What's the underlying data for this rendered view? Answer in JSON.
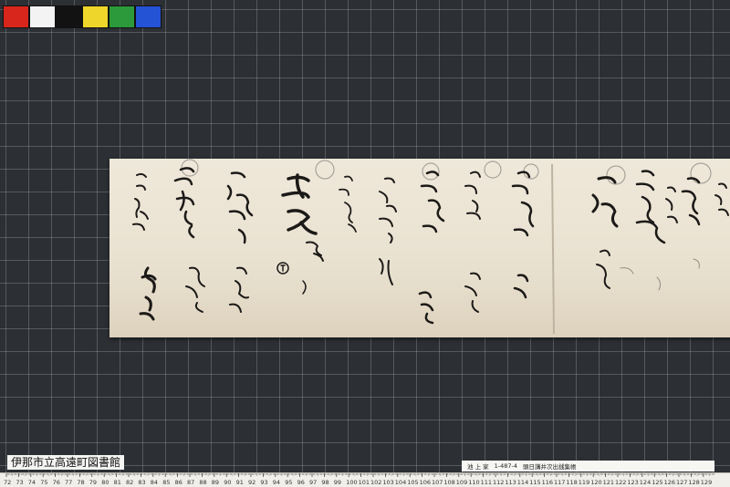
{
  "color_chart": {
    "swatches": [
      "#d9261c",
      "#f3f3f3",
      "#121212",
      "#efd62a",
      "#2c9a3a",
      "#2453d6"
    ]
  },
  "library_label": "伊那市立高遠町図書館",
  "catalog": {
    "location": "池 上 家",
    "number": "1-487-4",
    "title": "頭日講井次出銭集帳"
  },
  "ruler": {
    "ticks": [
      "72",
      "73",
      "74",
      "75",
      "76",
      "77",
      "78",
      "79",
      "80",
      "81",
      "82",
      "83",
      "84",
      "85",
      "86",
      "87",
      "88",
      "89",
      "90",
      "91",
      "92",
      "93",
      "94",
      "95",
      "96",
      "97",
      "98",
      "99",
      "100",
      "101",
      "102",
      "103",
      "104",
      "105",
      "106",
      "107",
      "108",
      "109",
      "110",
      "111",
      "112",
      "113",
      "114",
      "115",
      "116",
      "117",
      "118",
      "119",
      "120",
      "121",
      "122",
      "123",
      "124",
      "125",
      "126",
      "127",
      "128",
      "129"
    ]
  }
}
